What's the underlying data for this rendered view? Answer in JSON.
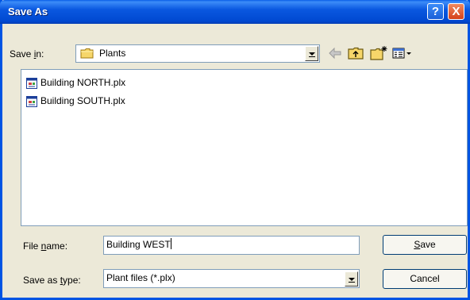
{
  "window": {
    "title": "Save As"
  },
  "title_buttons": {
    "help": "?",
    "close": "X"
  },
  "save_in": {
    "label_pre": "Save ",
    "label_key": "i",
    "label_post": "n:",
    "value": "Plants"
  },
  "toolbar": [
    "back-arrow-icon",
    "up-folder-icon",
    "new-folder-icon",
    "view-menu-icon"
  ],
  "files": [
    {
      "name": "Building NORTH.plx"
    },
    {
      "name": "Building SOUTH.plx"
    }
  ],
  "file_name": {
    "label_pre": "File ",
    "label_key": "n",
    "label_post": "ame:",
    "value": "Building WEST"
  },
  "save_type": {
    "label_pre": "Save as ",
    "label_key": "t",
    "label_post": "ype:",
    "value": "Plant files (*.plx)"
  },
  "buttons": {
    "save_key": "S",
    "save_rest": "ave",
    "cancel": "Cancel"
  },
  "colors": {
    "titlebar": "#0a58e0",
    "dialog_bg": "#ece9d8",
    "close": "#d4411b"
  }
}
